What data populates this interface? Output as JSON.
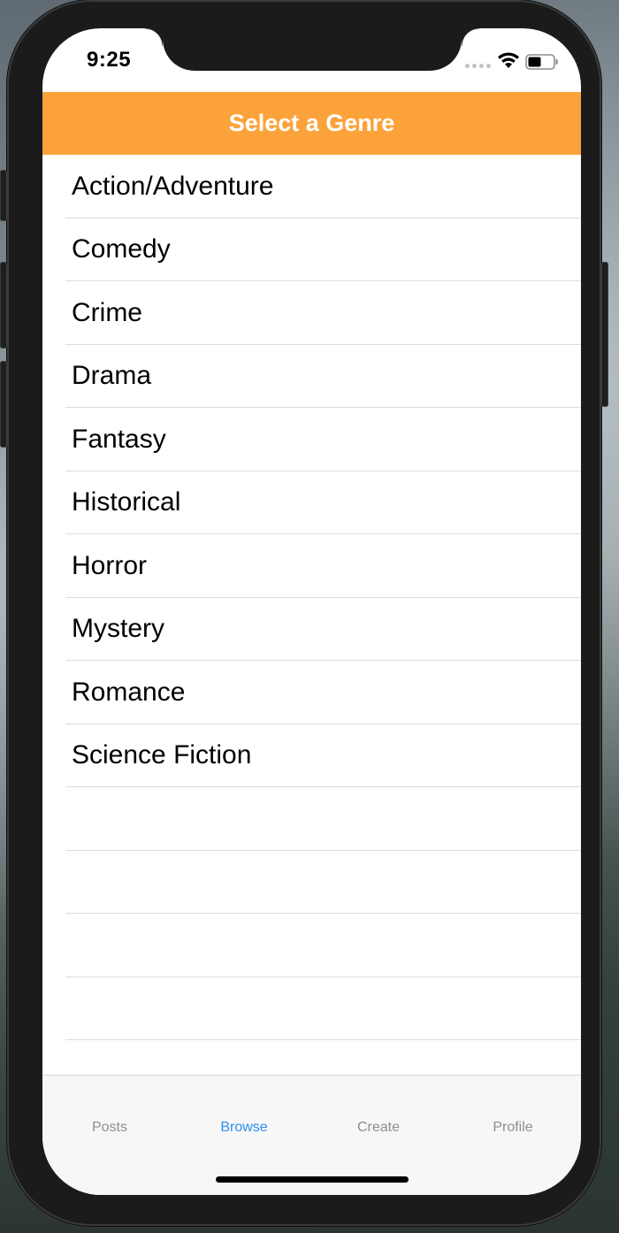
{
  "status_bar": {
    "time": "9:25",
    "icons": [
      "cellular-signal-icon",
      "wifi-icon",
      "battery-icon"
    ]
  },
  "nav": {
    "title": "Select a Genre",
    "background_color": "#fba33a"
  },
  "genres": [
    "Action/Adventure",
    "Comedy",
    "Crime",
    "Drama",
    "Fantasy",
    "Historical",
    "Horror",
    "Mystery",
    "Romance",
    "Science Fiction"
  ],
  "tabs": [
    {
      "label": "Posts",
      "active": false
    },
    {
      "label": "Browse",
      "active": true
    },
    {
      "label": "Create",
      "active": false
    },
    {
      "label": "Profile",
      "active": false
    }
  ],
  "colors": {
    "accent": "#2d8ff0",
    "inactive_tab": "#8e8e93"
  }
}
